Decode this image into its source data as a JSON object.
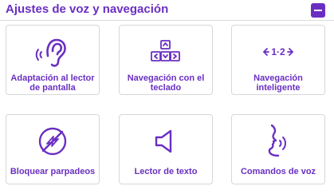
{
  "panel": {
    "title": "Ajustes de voz y navegación",
    "accent_color": "#6a2fc2",
    "collapse_icon": "minus-icon"
  },
  "cards": [
    {
      "label": "Adaptación al lector de pantalla",
      "icon": "ear-icon"
    },
    {
      "label": "Navegación con el teclado",
      "icon": "keyboard-arrows-icon"
    },
    {
      "label": "Navegación inteligente",
      "icon": "smart-navigation-icon",
      "icon_text": "‹·1·2·›"
    },
    {
      "label": "Bloquear parpadeos",
      "icon": "block-flashing-icon"
    },
    {
      "label": "Lector de texto",
      "icon": "speaker-icon"
    },
    {
      "label": "Comandos de voz",
      "icon": "voice-commands-icon"
    }
  ]
}
